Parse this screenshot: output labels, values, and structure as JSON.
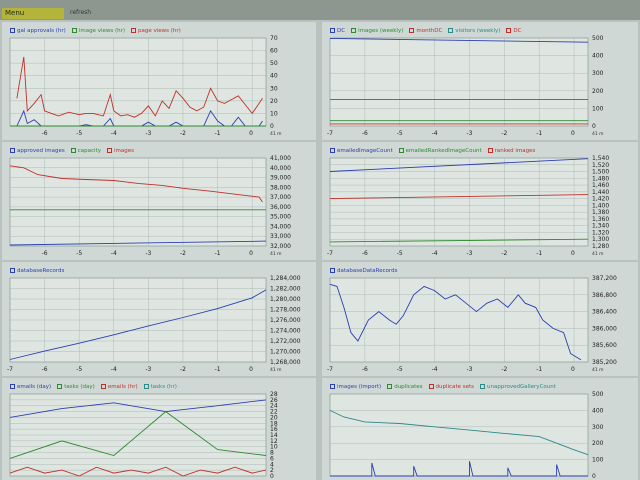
{
  "menu": {
    "label": "Menu"
  },
  "refresh": {
    "label": "refresh"
  },
  "colors": {
    "blue": "#2b3fb0",
    "green": "#2e8a2e",
    "red": "#c0302a",
    "teal": "#2a8a8a",
    "grid": "#9fb0aa",
    "axis": "#333"
  },
  "panels": [
    {
      "id": "p1",
      "legend": [
        {
          "label": "gal approvals (hr)",
          "color": "#2b3fb0"
        },
        {
          "label": "image views (hr)",
          "color": "#2e8a2e"
        },
        {
          "label": "page views (hr)",
          "color": "#c0302a"
        }
      ],
      "chart_data": {
        "type": "line",
        "x_ticks": [
          "-6",
          "-5",
          "-4",
          "-3",
          "-2",
          "-1",
          "0"
        ],
        "y_ticks": [
          "0",
          "10",
          "20",
          "30",
          "40",
          "50",
          "60",
          "70"
        ],
        "ylim": [
          0,
          70
        ],
        "corner_label": "41 m",
        "series": [
          {
            "color": "#c0302a",
            "x": [
              -6.8,
              -6.6,
              -6.5,
              -6.3,
              -6.1,
              -6.0,
              -5.8,
              -5.6,
              -5.3,
              -5.0,
              -4.8,
              -4.6,
              -4.3,
              -4.1,
              -4.0,
              -3.8,
              -3.6,
              -3.4,
              -3.2,
              -3.0,
              -2.8,
              -2.6,
              -2.4,
              -2.2,
              -2.0,
              -1.8,
              -1.6,
              -1.4,
              -1.2,
              -1.0,
              -0.8,
              -0.6,
              -0.4,
              -0.2,
              0.0,
              0.2,
              0.3
            ],
            "y": [
              22,
              55,
              12,
              18,
              25,
              12,
              10,
              8,
              11,
              9,
              10,
              10,
              8,
              25,
              12,
              8,
              9,
              7,
              10,
              16,
              8,
              20,
              14,
              28,
              22,
              15,
              12,
              15,
              30,
              20,
              18,
              21,
              24,
              17,
              10,
              18,
              22
            ]
          },
          {
            "color": "#2b3fb0",
            "x": [
              -6.8,
              -6.6,
              -6.5,
              -6.3,
              -6.1,
              -6.0,
              -5.8,
              -5.6,
              -5.3,
              -5.0,
              -4.8,
              -4.6,
              -4.3,
              -4.1,
              -4.0,
              -3.8,
              -3.6,
              -3.4,
              -3.2,
              -3.0,
              -2.8,
              -2.6,
              -2.4,
              -2.2,
              -2.0,
              -1.8,
              -1.6,
              -1.4,
              -1.2,
              -1.0,
              -0.8,
              -0.6,
              -0.4,
              -0.2,
              0.0,
              0.2,
              0.3
            ],
            "y": [
              0,
              12,
              2,
              5,
              0,
              0,
              0,
              0,
              0,
              0,
              1,
              0,
              0,
              6,
              0,
              0,
              0,
              0,
              0,
              3,
              0,
              0,
              0,
              3,
              0,
              0,
              0,
              0,
              12,
              4,
              0,
              0,
              7,
              0,
              0,
              0,
              4
            ]
          },
          {
            "color": "#2e8a2e",
            "x": [
              -7,
              0.4
            ],
            "y": [
              0,
              0
            ]
          }
        ]
      }
    },
    {
      "id": "p2",
      "legend": [
        {
          "label": "DC",
          "color": "#2b3fb0"
        },
        {
          "label": "images (weekly)",
          "color": "#2e8a2e"
        },
        {
          "label": "monthDC",
          "color": "#c0302a"
        },
        {
          "label": "visitors (weekly)",
          "color": "#2a8a8a"
        },
        {
          "label": "DC",
          "color": "#c0302a"
        }
      ],
      "chart_data": {
        "type": "line",
        "x_ticks": [
          "-7",
          "-6",
          "-5",
          "-4",
          "-3",
          "-2",
          "-1",
          "0"
        ],
        "y_ticks": [
          "0",
          "100",
          "200",
          "300",
          "400",
          "500"
        ],
        "ylim": [
          0,
          500
        ],
        "corner_label": "41 m",
        "series": [
          {
            "color": "#2b3fb0",
            "x": [
              -7,
              0.4
            ],
            "y": [
              498,
              476
            ]
          },
          {
            "color": "#c0302a",
            "x": [
              -7,
              0.4
            ],
            "y": [
              150,
              150
            ]
          },
          {
            "color": "#2e8a2e",
            "x": [
              -7,
              0.4
            ],
            "y": [
              30,
              30
            ]
          },
          {
            "color": "#c0302a",
            "x": [
              -7,
              0.4
            ],
            "y": [
              12,
              12
            ]
          }
        ]
      }
    },
    {
      "id": "p3",
      "legend": [
        {
          "label": "approved images",
          "color": "#2b3fb0"
        },
        {
          "label": "capacity",
          "color": "#2e8a2e"
        },
        {
          "label": "images",
          "color": "#c0302a"
        }
      ],
      "chart_data": {
        "type": "line",
        "x_ticks": [
          "-6",
          "-5",
          "-4",
          "-3",
          "-2",
          "-1",
          "0"
        ],
        "y_ticks": [
          "32,000",
          "33,000",
          "34,000",
          "35,000",
          "36,000",
          "37,000",
          "38,000",
          "39,000",
          "40,000",
          "41,000"
        ],
        "ylim": [
          32000,
          41000
        ],
        "corner_label": "41 m",
        "series": [
          {
            "color": "#c0302a",
            "x": [
              -7,
              -6.6,
              -6.2,
              -5.5,
              -4.8,
              -4.0,
              -3.3,
              -2.6,
              -2.0,
              -1.2,
              -0.5,
              0.2,
              0.3
            ],
            "y": [
              40200,
              40000,
              39300,
              38900,
              38800,
              38700,
              38400,
              38200,
              37900,
              37600,
              37300,
              37000,
              36500
            ]
          },
          {
            "color": "#2e8a2e",
            "x": [
              -7,
              0.4
            ],
            "y": [
              35700,
              35700
            ]
          },
          {
            "color": "#2b3fb0",
            "x": [
              -7,
              0.4
            ],
            "y": [
              32100,
              32500
            ]
          }
        ]
      }
    },
    {
      "id": "p4",
      "legend": [
        {
          "label": "emailedImageCount",
          "color": "#2b3fb0"
        },
        {
          "label": "emailedRankedImageCount",
          "color": "#2e8a2e"
        },
        {
          "label": "ranked images",
          "color": "#c0302a"
        }
      ],
      "chart_data": {
        "type": "line",
        "x_ticks": [
          "-7",
          "-6",
          "-5",
          "-4",
          "-3",
          "-2",
          "-1",
          "0"
        ],
        "y_ticks": [
          "1,280",
          "1,300",
          "1,320",
          "1,340",
          "1,360",
          "1,380",
          "1,400",
          "1,420",
          "1,440",
          "1,460",
          "1,480",
          "1,500",
          "1,520",
          "1,540"
        ],
        "ylim": [
          1280,
          1540
        ],
        "corner_label": "41 m",
        "series": [
          {
            "color": "#2b3fb0",
            "x": [
              -7,
              0.4
            ],
            "y": [
              1500,
              1538
            ]
          },
          {
            "color": "#c0302a",
            "x": [
              -7,
              0.4
            ],
            "y": [
              1420,
              1432
            ]
          },
          {
            "color": "#2e8a2e",
            "x": [
              -7,
              0.4
            ],
            "y": [
              1292,
              1300
            ]
          }
        ]
      }
    },
    {
      "id": "p5",
      "legend": [
        {
          "label": "databaseRecords",
          "color": "#2b3fb0"
        }
      ],
      "chart_data": {
        "type": "line",
        "x_ticks": [
          "-7",
          "-6",
          "-5",
          "-4",
          "-3",
          "-2",
          "-1",
          "0"
        ],
        "y_ticks": [
          "1,268,000",
          "1,270,000",
          "1,272,000",
          "1,274,000",
          "1,276,000",
          "1,278,000",
          "1,280,000",
          "1,282,000",
          "1,284,000"
        ],
        "ylim": [
          1268000,
          1285000
        ],
        "corner_label": "41 m",
        "series": [
          {
            "color": "#2b3fb0",
            "x": [
              -7,
              -6,
              -5,
              -4,
              -3,
              -2,
              -1,
              0,
              0.4
            ],
            "y": [
              1268500,
              1270200,
              1271800,
              1273500,
              1275300,
              1277000,
              1278800,
              1281000,
              1282600
            ]
          }
        ]
      }
    },
    {
      "id": "p6",
      "legend": [
        {
          "label": "databaseDataRecords",
          "color": "#2b3fb0"
        }
      ],
      "chart_data": {
        "type": "line",
        "x_ticks": [
          "-7",
          "-6",
          "-5",
          "-4",
          "-3",
          "-2",
          "-1",
          "0"
        ],
        "y_ticks": [
          "385,200",
          "385,600",
          "386,000",
          "386,400",
          "386,800",
          "387,200"
        ],
        "ylim": [
          385200,
          387200
        ],
        "corner_label": "41 m",
        "series": [
          {
            "color": "#2b3fb0",
            "x": [
              -7,
              -6.8,
              -6.6,
              -6.4,
              -6.2,
              -5.9,
              -5.6,
              -5.3,
              -5.1,
              -4.9,
              -4.6,
              -4.3,
              -4.0,
              -3.7,
              -3.4,
              -3.1,
              -2.8,
              -2.5,
              -2.2,
              -1.9,
              -1.6,
              -1.4,
              -1.1,
              -0.9,
              -0.6,
              -0.3,
              -0.1,
              0.2
            ],
            "y": [
              387050,
              387000,
              386500,
              385900,
              385700,
              386200,
              386400,
              386200,
              386100,
              386300,
              386800,
              387000,
              386900,
              386700,
              386800,
              386600,
              386400,
              386600,
              386700,
              386500,
              386800,
              386600,
              386500,
              386200,
              386000,
              385900,
              385400,
              385250
            ]
          }
        ]
      }
    },
    {
      "id": "p7",
      "legend": [
        {
          "label": "emails (day)",
          "color": "#2b3fb0"
        },
        {
          "label": "tasks (day)",
          "color": "#2e8a2e"
        },
        {
          "label": "emails (hr)",
          "color": "#c0302a"
        },
        {
          "label": "tasks (hr)",
          "color": "#2a8a8a"
        }
      ],
      "chart_data": {
        "type": "line",
        "x_ticks": [],
        "y_ticks": [
          "0",
          "2",
          "4",
          "6",
          "8",
          "10",
          "12",
          "14",
          "16",
          "18",
          "20",
          "22",
          "24",
          "26",
          "28"
        ],
        "ylim": [
          0,
          28
        ],
        "corner_label": "",
        "series": [
          {
            "color": "#2b3fb0",
            "x": [
              -7,
              -5.5,
              -4,
              -2.5,
              -1,
              0.4
            ],
            "y": [
              20,
              23,
              25,
              22,
              24,
              26
            ]
          },
          {
            "color": "#2e8a2e",
            "x": [
              -7,
              -5.5,
              -4,
              -2.5,
              -1,
              0.4
            ],
            "y": [
              6,
              12,
              7,
              22,
              9,
              7
            ]
          },
          {
            "color": "#c0302a",
            "x": [
              -7,
              -6.5,
              -6,
              -5.5,
              -5,
              -4.5,
              -4,
              -3.5,
              -3,
              -2.5,
              -2,
              -1.5,
              -1,
              -0.5,
              0,
              0.4
            ],
            "y": [
              1,
              3,
              1,
              2,
              0,
              3,
              1,
              2,
              1,
              3,
              0,
              2,
              1,
              3,
              1,
              2
            ]
          }
        ]
      }
    },
    {
      "id": "p8",
      "legend": [
        {
          "label": "images (import)",
          "color": "#2b3fb0"
        },
        {
          "label": "duplicates",
          "color": "#2e8a2e"
        },
        {
          "label": "duplicate sets",
          "color": "#c0302a"
        },
        {
          "label": "unapprovedGalleryCount",
          "color": "#2a8a8a"
        }
      ],
      "chart_data": {
        "type": "line",
        "x_ticks": [],
        "y_ticks": [
          "0",
          "100",
          "200",
          "300",
          "400",
          "500"
        ],
        "ylim": [
          0,
          500
        ],
        "corner_label": "",
        "series": [
          {
            "color": "#2a8a8a",
            "x": [
              -7,
              -6.6,
              -6.0,
              -5.0,
              -4.0,
              -3.0,
              -2.0,
              -1.0,
              -0.5,
              0.0,
              0.4
            ],
            "y": [
              400,
              360,
              330,
              320,
              300,
              280,
              260,
              240,
              200,
              160,
              130
            ]
          },
          {
            "color": "#2b3fb0",
            "x": [
              -7,
              -5.8,
              -5.8,
              -5.7,
              -4.6,
              -4.6,
              -4.5,
              -3.0,
              -3.0,
              -2.9,
              -1.9,
              -1.9,
              -1.8,
              -0.5,
              -0.5,
              -0.4,
              0.4
            ],
            "y": [
              0,
              0,
              80,
              0,
              0,
              60,
              0,
              0,
              90,
              0,
              0,
              50,
              0,
              0,
              70,
              0,
              0
            ]
          }
        ]
      }
    }
  ]
}
